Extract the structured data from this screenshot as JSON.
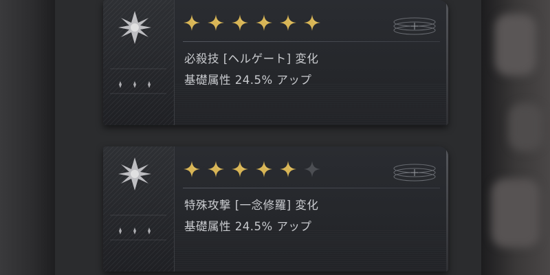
{
  "cards": [
    {
      "rating": 6,
      "max_rating": 6,
      "title": "必殺技 [ヘルゲート] 変化",
      "effect": "基礎属性 24.5% アップ"
    },
    {
      "rating": 5,
      "max_rating": 6,
      "title": "特殊攻撃 [一念修羅] 変化",
      "effect": "基礎属性 24.5% アップ"
    }
  ],
  "colors": {
    "star_filled": "#d8b556",
    "star_empty": "#4c4e53",
    "text": "#c9cbcf"
  },
  "icons": [
    "emblem-star-icon",
    "star-icon",
    "rings-icon"
  ]
}
